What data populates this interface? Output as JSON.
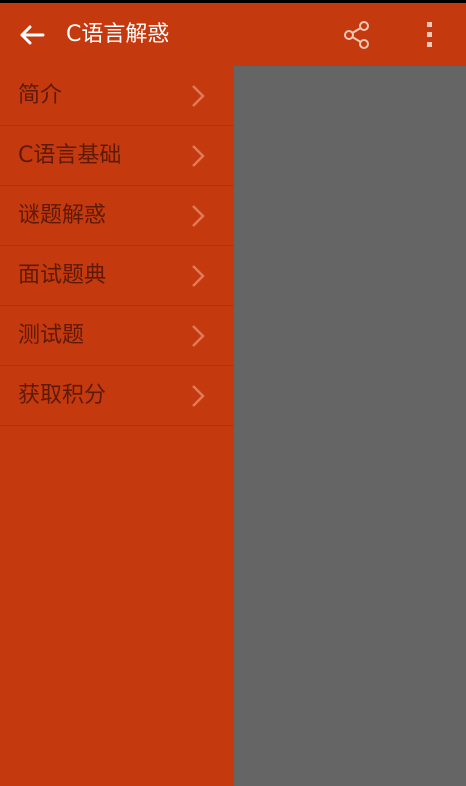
{
  "appbar": {
    "title": "C语言解惑",
    "back_icon": "arrow-left-icon",
    "share_icon": "share-icon",
    "more_icon": "more-vertical-icon"
  },
  "drawer": {
    "items": [
      {
        "label": "简介"
      },
      {
        "label": "C语言基础"
      },
      {
        "label": "谜题解惑"
      },
      {
        "label": "面试题典"
      },
      {
        "label": "测试题"
      },
      {
        "label": "获取积分"
      }
    ]
  },
  "colors": {
    "primary": "#c4390e",
    "menu_text": "#5e1a06",
    "scrim": "#656565"
  }
}
